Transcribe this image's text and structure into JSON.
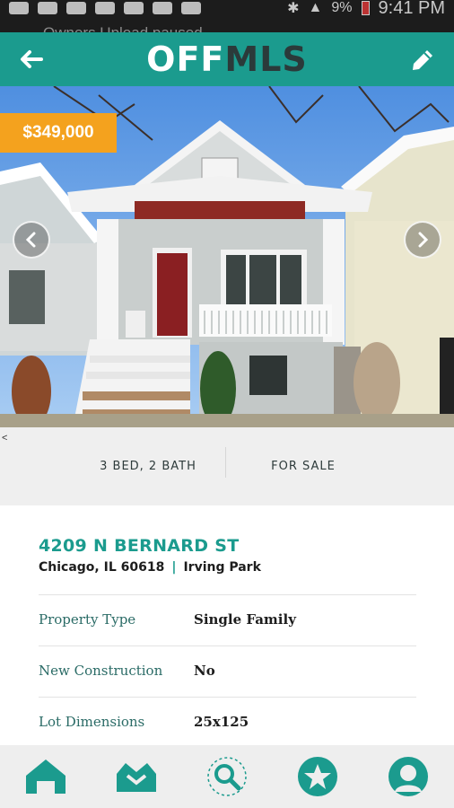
{
  "status_bar": {
    "notification_text": "Owners Upload paused",
    "battery": "9%",
    "time": "9:41 PM"
  },
  "header": {
    "logo_part1": "OFF",
    "logo_part2": "MLS",
    "back_icon": "arrow-left-icon",
    "edit_icon": "pencil-icon",
    "brand_color": "#1b9b8e"
  },
  "listing": {
    "price": "$349,000",
    "beds_baths": "3 BED, 2 BATH",
    "status": "FOR SALE",
    "address": "4209 N BERNARD ST",
    "city": "Chicago, IL 60618",
    "neighborhood_sep": "|",
    "neighborhood": "Irving Park",
    "tiny_marker": "<"
  },
  "details": [
    {
      "label": "Property Type",
      "value": "Single Family"
    },
    {
      "label": "New Construction",
      "value": "No"
    },
    {
      "label": "Lot Dimensions",
      "value": "25x125"
    }
  ],
  "bottom_nav": {
    "items": [
      "home-icon",
      "owners-icon",
      "search-icon",
      "favorites-star-icon",
      "profile-icon"
    ]
  }
}
